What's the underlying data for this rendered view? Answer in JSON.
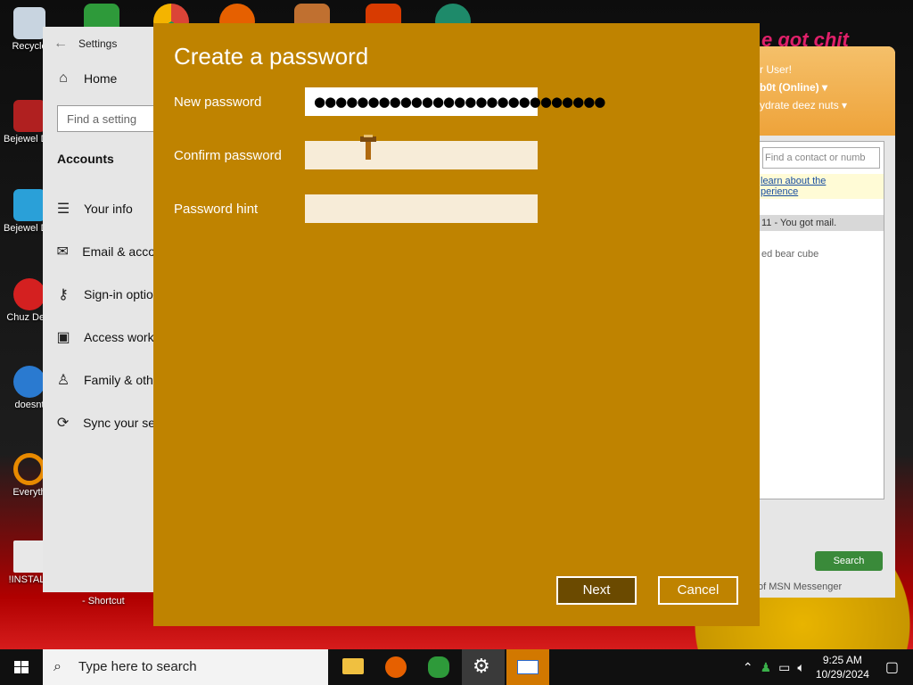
{
  "desktop": {
    "icons": [
      {
        "label": "Recycle"
      },
      {
        "label": "Bejewel Delu"
      },
      {
        "label": "Bejewel Delu"
      },
      {
        "label": "Chuz Delu"
      },
      {
        "label": "doesnt"
      },
      {
        "label": "Everyth"
      },
      {
        "label": "!INSTALL"
      }
    ],
    "shortcut_label": "- Shortcut"
  },
  "settings": {
    "title": "Settings",
    "home_label": "Home",
    "find_placeholder": "Find a setting",
    "section": "Accounts",
    "nav": [
      {
        "label": "Your info"
      },
      {
        "label": "Email & acco"
      },
      {
        "label": "Sign-in optio"
      },
      {
        "label": "Access work"
      },
      {
        "label": "Family & oth"
      },
      {
        "label": "Sync your se"
      }
    ]
  },
  "messenger": {
    "promo_text": "e got chit",
    "user_line": "r User!",
    "status": "b0t (Online) ▾",
    "message": "ydrate deez nuts ▾",
    "find_contact_placeholder": "Find a contact or numb",
    "link_line1": "learn about the",
    "link_line2": "perience",
    "mail_notice": "11 - You got mail.",
    "contact": "ed bear cube",
    "search_label": "Search",
    "footer": "of MSN Messenger"
  },
  "dialog": {
    "title": "Create a password",
    "new_password_label": "New password",
    "new_password_value": "●●●●●●●●●●●●●●●●●●●●●●●●●●●",
    "confirm_password_label": "Confirm password",
    "password_hint_label": "Password hint",
    "next_label": "Next",
    "cancel_label": "Cancel",
    "accent_color": "#bf8300"
  },
  "taskbar": {
    "search_placeholder": "Type here to search",
    "time": "9:25 AM",
    "date": "10/29/2024"
  }
}
